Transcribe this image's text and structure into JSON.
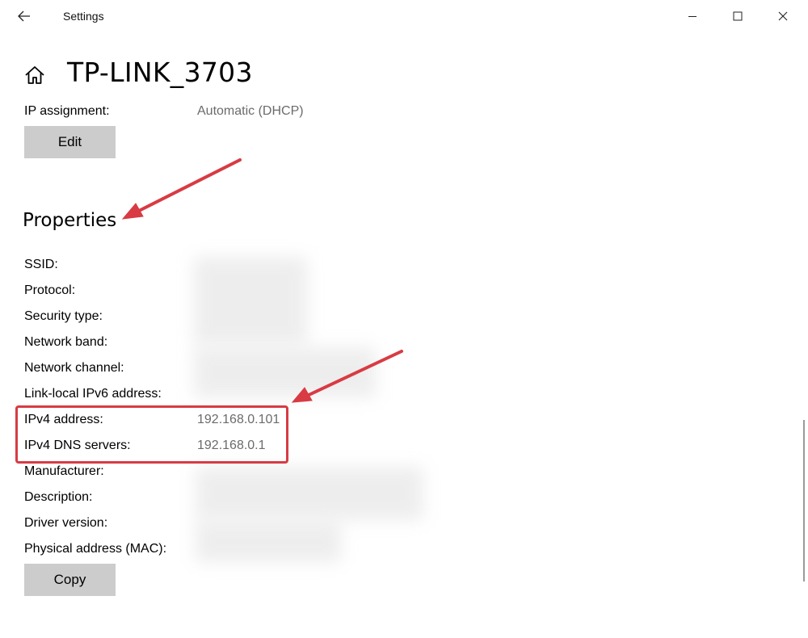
{
  "window": {
    "app_title": "Settings",
    "back_icon": "back-arrow-icon",
    "min_icon": "minimize-icon",
    "max_icon": "maximize-icon",
    "close_icon": "close-icon"
  },
  "header": {
    "home_icon": "home-icon",
    "title": "TP-LINK_3703"
  },
  "ip_settings": {
    "label": "IP assignment:",
    "value": "Automatic (DHCP)",
    "edit_label": "Edit"
  },
  "properties": {
    "title": "Properties",
    "rows": [
      {
        "label": "SSID:",
        "value": ""
      },
      {
        "label": "Protocol:",
        "value": ""
      },
      {
        "label": "Security type:",
        "value": ""
      },
      {
        "label": "Network band:",
        "value": ""
      },
      {
        "label": "Network channel:",
        "value": ""
      },
      {
        "label": "Link-local IPv6 address:",
        "value": ""
      },
      {
        "label": "IPv4 address:",
        "value": "192.168.0.101"
      },
      {
        "label": "IPv4 DNS servers:",
        "value": "192.168.0.1"
      },
      {
        "label": "Manufacturer:",
        "value": ""
      },
      {
        "label": "Description:",
        "value": ""
      },
      {
        "label": "Driver version:",
        "value": ""
      },
      {
        "label": "Physical address (MAC):",
        "value": ""
      }
    ],
    "copy_label": "Copy"
  },
  "colors": {
    "annotation": "#d83b43",
    "button_bg": "#cccccc",
    "value_text": "#6b6b6b"
  }
}
